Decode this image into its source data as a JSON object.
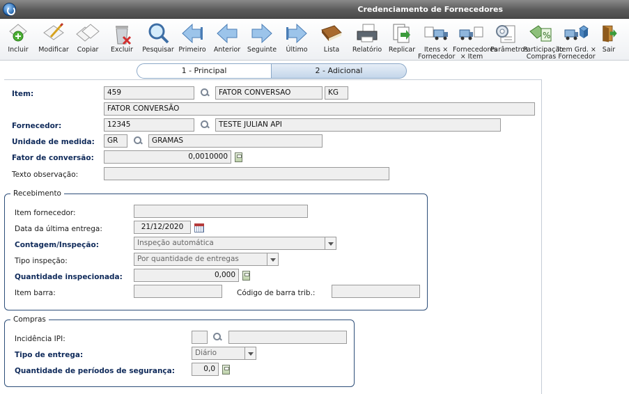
{
  "window": {
    "title": "Credenciamento de Fornecedores"
  },
  "toolbar": {
    "buttons": [
      {
        "label": "Incluir",
        "icon": "add-doc-icon"
      },
      {
        "label": "Modificar",
        "icon": "edit-doc-icon"
      },
      {
        "label": "Copiar",
        "icon": "copy-doc-icon"
      },
      {
        "label": "Excluir",
        "icon": "trash-icon"
      },
      {
        "label": "Pesquisar",
        "icon": "magnifier-icon"
      },
      {
        "label": "Primeiro",
        "icon": "first-arrow-icon"
      },
      {
        "label": "Anterior",
        "icon": "previous-arrow-icon"
      },
      {
        "label": "Seguinte",
        "icon": "next-arrow-icon"
      },
      {
        "label": "Último",
        "icon": "last-arrow-icon"
      },
      {
        "label": "Lista",
        "icon": "book-icon"
      },
      {
        "label": "Relatório",
        "icon": "printer-icon"
      },
      {
        "label": "Replicar",
        "icon": "replicate-icon"
      },
      {
        "label": "Itens ×\nFornecedor",
        "icon": "items-truck-icon"
      },
      {
        "label": "Fornecedores\n× Item",
        "icon": "suppliers-truck-icon"
      },
      {
        "label": "Parâmetros",
        "icon": "parameters-icon"
      },
      {
        "label": "Participação\nCompras",
        "icon": "percent-money-icon"
      },
      {
        "label": "Item Grd. ×\nFornecedor",
        "icon": "grid-truck-icon"
      },
      {
        "label": "Sair",
        "icon": "exit-door-icon"
      }
    ]
  },
  "tabs": [
    {
      "label": "1 - Principal"
    },
    {
      "label": "2 - Adicional"
    }
  ],
  "form": {
    "item": {
      "label": "Item:",
      "code": "459",
      "name": "FATOR CONVERSAO",
      "unit": "KG",
      "description": "FATOR CONVERSÃO"
    },
    "fornecedor": {
      "label": "Fornecedor:",
      "code": "12345",
      "name": "TESTE JULIAN API"
    },
    "unidade": {
      "label": "Unidade de medida:",
      "code": "GR",
      "name": "GRAMAS"
    },
    "fator": {
      "label": "Fator de conversão:",
      "value": "0,0010000"
    },
    "observacao": {
      "label": "Texto observação:",
      "value": ""
    }
  },
  "recebimento": {
    "title": "Recebimento",
    "item_fornecedor": {
      "label": "Item fornecedor:",
      "value": ""
    },
    "data_entrega": {
      "label": "Data da última entrega:",
      "value": "21/12/2020"
    },
    "contagem": {
      "label": "Contagem/Inspeção:",
      "value": "Inspeção automática"
    },
    "tipo_inspecao": {
      "label": "Tipo inspeção:",
      "value": "Por quantidade de entregas"
    },
    "quantidade": {
      "label": "Quantidade inspecionada:",
      "value": "0,000"
    },
    "item_barra": {
      "label": "Item barra:",
      "value": ""
    },
    "codigo_barra": {
      "label": "Código de barra trib.:",
      "value": ""
    }
  },
  "compras": {
    "title": "Compras",
    "incidencia": {
      "label": "Incidência IPI:",
      "code": "",
      "name": ""
    },
    "tipo_entrega": {
      "label": "Tipo de entrega:",
      "value": "Diário"
    },
    "periodos": {
      "label": "Quantidade de períodos de segurança:",
      "value": "0,0"
    }
  }
}
